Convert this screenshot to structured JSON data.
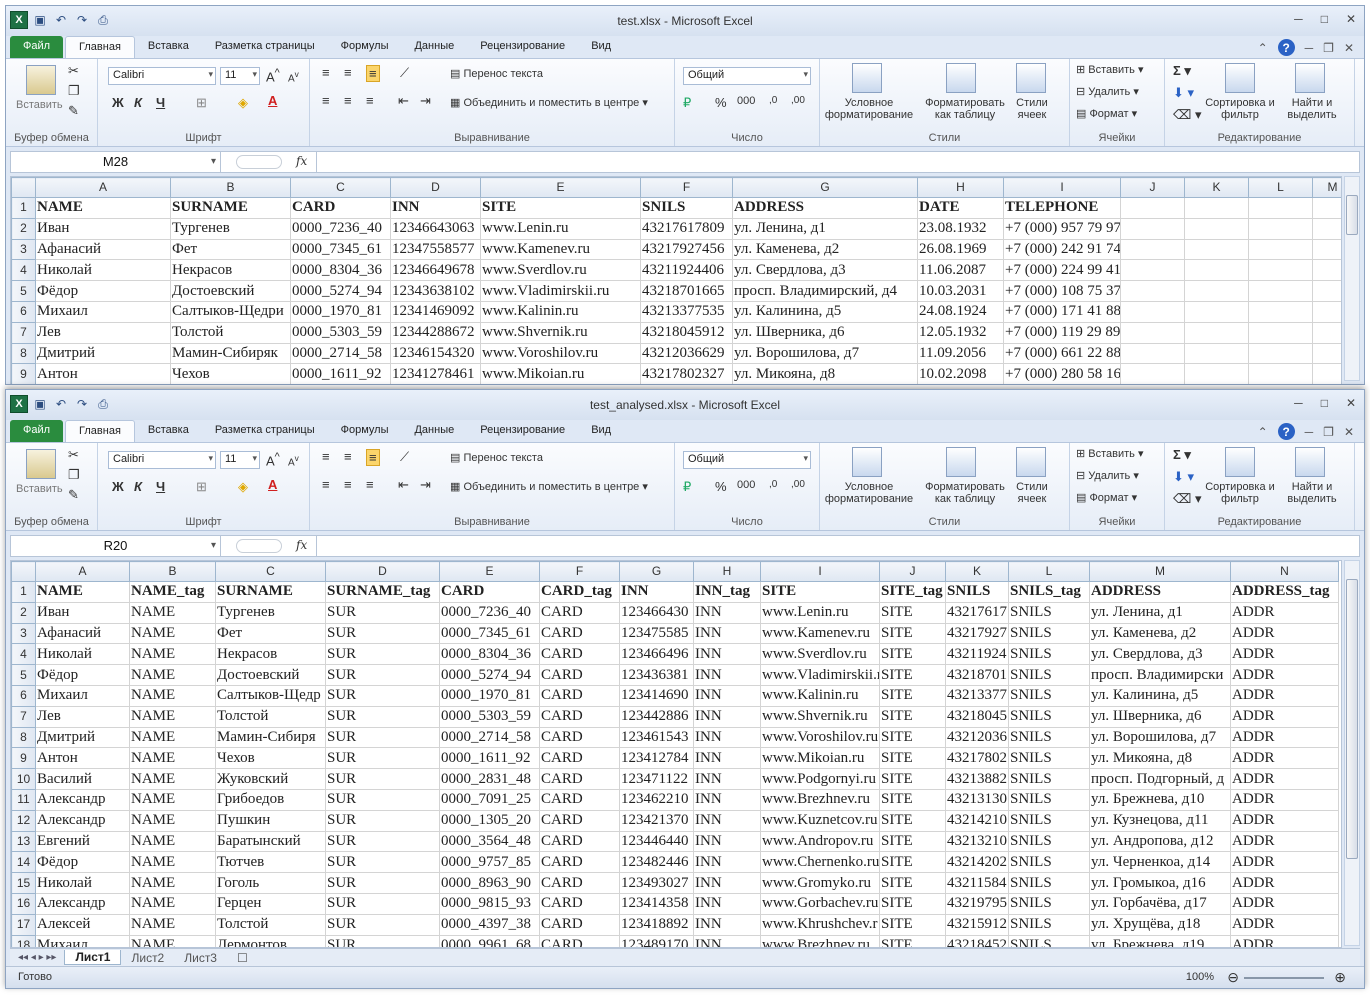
{
  "app": {
    "quick_access": [
      "save-icon",
      "undo-icon",
      "redo-icon",
      "print-preview-icon"
    ]
  },
  "window1": {
    "title": "test.xlsx  -  Microsoft Excel",
    "tabs": [
      "Файл",
      "Главная",
      "Вставка",
      "Разметка страницы",
      "Формулы",
      "Данные",
      "Рецензирование",
      "Вид"
    ],
    "namebox": "M28",
    "columns": [
      "A",
      "B",
      "C",
      "D",
      "E",
      "F",
      "G",
      "H",
      "I",
      "J",
      "K",
      "L",
      "M"
    ],
    "rows": [
      [
        "NAME",
        "SURNAME",
        "CARD",
        "INN",
        "SITE",
        "SNILS",
        "ADDRESS",
        "DATE",
        "TELEPHONE",
        "",
        "",
        "",
        ""
      ],
      [
        "Иван",
        "Тургенев",
        "0000_7236_40",
        "12346643063",
        "www.Lenin.ru",
        "43217617809",
        "ул. Ленина, д1",
        "23.08.1932",
        "+7 (000) 957 79 97",
        "",
        "",
        "",
        ""
      ],
      [
        "Афанасий",
        "Фет",
        "0000_7345_61",
        "12347558577",
        "www.Kamenev.ru",
        "43217927456",
        "ул. Каменева, д2",
        "26.08.1969",
        "+7 (000) 242 91 74",
        "",
        "",
        "",
        ""
      ],
      [
        "Николай",
        "Некрасов",
        "0000_8304_36",
        "12346649678",
        "www.Sverdlov.ru",
        "43211924406",
        "ул. Свердлова, д3",
        "11.06.2087",
        "+7 (000) 224 99 41",
        "",
        "",
        "",
        ""
      ],
      [
        "Фёдор",
        "Достоевский",
        "0000_5274_94",
        "12343638102",
        "www.Vladimirskii.ru",
        "43218701665",
        "просп. Владимирский, д4",
        "10.03.2031",
        "+7 (000) 108 75 37",
        "",
        "",
        "",
        ""
      ],
      [
        "Михаил",
        "Салтыков-Щедри",
        "0000_1970_81",
        "12341469092",
        "www.Kalinin.ru",
        "43213377535",
        "ул. Калинина, д5",
        "24.08.1924",
        "+7 (000) 171 41 88",
        "",
        "",
        "",
        ""
      ],
      [
        "Лев",
        "Толстой",
        "0000_5303_59",
        "12344288672",
        "www.Shvernik.ru",
        "43218045912",
        "ул. Шверника, д6",
        "12.05.1932",
        "+7 (000) 119 29 89",
        "",
        "",
        "",
        ""
      ],
      [
        "Дмитрий",
        "Мамин-Сибиряк",
        "0000_2714_58",
        "12346154320",
        "www.Voroshilov.ru",
        "43212036629",
        "ул. Ворошилова, д7",
        "11.09.2056",
        "+7 (000) 661 22 88",
        "",
        "",
        "",
        ""
      ],
      [
        "Антон",
        "Чехов",
        "0000_1611_92",
        "12341278461",
        "www.Mikoian.ru",
        "43217802327",
        "ул. Микояна, д8",
        "10.02.2098",
        "+7 (000) 280 58 16",
        "",
        "",
        "",
        ""
      ]
    ]
  },
  "window2": {
    "title": "test_analysed.xlsx  -  Microsoft Excel",
    "tabs": [
      "Файл",
      "Главная",
      "Вставка",
      "Разметка страницы",
      "Формулы",
      "Данные",
      "Рецензирование",
      "Вид"
    ],
    "namebox": "R20",
    "columns": [
      "A",
      "B",
      "C",
      "D",
      "E",
      "F",
      "G",
      "H",
      "I",
      "J",
      "K",
      "L",
      "M",
      "N"
    ],
    "rows": [
      [
        "NAME",
        "NAME_tag",
        "SURNAME",
        "SURNAME_tag",
        "CARD",
        "CARD_tag",
        "INN",
        "INN_tag",
        "SITE",
        "SITE_tag",
        "SNILS",
        "SNILS_tag",
        "ADDRESS",
        "ADDRESS_tag"
      ],
      [
        "Иван",
        "NAME",
        "Тургенев",
        "SUR",
        "0000_7236_40",
        "CARD",
        "123466430",
        "INN",
        "www.Lenin.ru",
        "SITE",
        "43217617",
        "SNILS",
        "ул. Ленина, д1",
        "ADDR"
      ],
      [
        "Афанасий",
        "NAME",
        "Фет",
        "SUR",
        "0000_7345_61",
        "CARD",
        "123475585",
        "INN",
        "www.Kamenev.ru",
        "SITE",
        "43217927",
        "SNILS",
        "ул. Каменева, д2",
        "ADDR"
      ],
      [
        "Николай",
        "NAME",
        "Некрасов",
        "SUR",
        "0000_8304_36",
        "CARD",
        "123466496",
        "INN",
        "www.Sverdlov.ru",
        "SITE",
        "43211924",
        "SNILS",
        "ул. Свердлова, д3",
        "ADDR"
      ],
      [
        "Фёдор",
        "NAME",
        "Достоевский",
        "SUR",
        "0000_5274_94",
        "CARD",
        "123436381",
        "INN",
        "www.Vladimirskii.r",
        "SITE",
        "43218701",
        "SNILS",
        "просп. Владимирски",
        "ADDR"
      ],
      [
        "Михаил",
        "NAME",
        "Салтыков-Щедр",
        "SUR",
        "0000_1970_81",
        "CARD",
        "123414690",
        "INN",
        "www.Kalinin.ru",
        "SITE",
        "43213377",
        "SNILS",
        "ул. Калинина, д5",
        "ADDR"
      ],
      [
        "Лев",
        "NAME",
        "Толстой",
        "SUR",
        "0000_5303_59",
        "CARD",
        "123442886",
        "INN",
        "www.Shvernik.ru",
        "SITE",
        "43218045",
        "SNILS",
        "ул. Шверника, д6",
        "ADDR"
      ],
      [
        "Дмитрий",
        "NAME",
        "Мамин-Сибиря",
        "SUR",
        "0000_2714_58",
        "CARD",
        "123461543",
        "INN",
        "www.Voroshilov.ru",
        "SITE",
        "43212036",
        "SNILS",
        "ул. Ворошилова, д7",
        "ADDR"
      ],
      [
        "Антон",
        "NAME",
        "Чехов",
        "SUR",
        "0000_1611_92",
        "CARD",
        "123412784",
        "INN",
        "www.Mikoian.ru",
        "SITE",
        "43217802",
        "SNILS",
        "ул. Микояна, д8",
        "ADDR"
      ],
      [
        "Василий",
        "NAME",
        "Жуковский",
        "SUR",
        "0000_2831_48",
        "CARD",
        "123471122",
        "INN",
        "www.Podgornyi.ru",
        "SITE",
        "43213882",
        "SNILS",
        "просп. Подгорный, д",
        "ADDR"
      ],
      [
        "Александр",
        "NAME",
        "Грибоедов",
        "SUR",
        "0000_7091_25",
        "CARD",
        "123462210",
        "INN",
        "www.Brezhnev.ru",
        "SITE",
        "43213130",
        "SNILS",
        "ул. Брежнева, д10",
        "ADDR"
      ],
      [
        "Александр",
        "NAME",
        "Пушкин",
        "SUR",
        "0000_1305_20",
        "CARD",
        "123421370",
        "INN",
        "www.Kuznetcov.ru",
        "SITE",
        "43214210",
        "SNILS",
        "ул. Кузнецова, д11",
        "ADDR"
      ],
      [
        "Евгений",
        "NAME",
        "Баратынский",
        "SUR",
        "0000_3564_48",
        "CARD",
        "123446440",
        "INN",
        "www.Andropov.ru",
        "SITE",
        "43213210",
        "SNILS",
        "ул. Андропова, д12",
        "ADDR"
      ],
      [
        "Фёдор",
        "NAME",
        "Тютчев",
        "SUR",
        "0000_9757_85",
        "CARD",
        "123482446",
        "INN",
        "www.Chernenko.ru",
        "SITE",
        "43214202",
        "SNILS",
        "ул. Черненкоа, д14",
        "ADDR"
      ],
      [
        "Николай",
        "NAME",
        "Гоголь",
        "SUR",
        "0000_8963_90",
        "CARD",
        "123493027",
        "INN",
        "www.Gromyko.ru",
        "SITE",
        "43211584",
        "SNILS",
        "ул. Громыкоа, д16",
        "ADDR"
      ],
      [
        "Александр",
        "NAME",
        "Герцен",
        "SUR",
        "0000_9815_93",
        "CARD",
        "123414358",
        "INN",
        "www.Gorbachev.ru",
        "SITE",
        "43219795",
        "SNILS",
        "ул. Горбачёва, д17",
        "ADDR"
      ],
      [
        "Алексей",
        "NAME",
        "Толстой",
        "SUR",
        "0000_4397_38",
        "CARD",
        "123418892",
        "INN",
        "www.Khrushchev.r",
        "SITE",
        "43215912",
        "SNILS",
        "ул. Хрущёва, д18",
        "ADDR"
      ],
      [
        "Михаил",
        "NAME",
        "Лермонтов",
        "SUR",
        "0000_9961_68",
        "CARD",
        "123489170",
        "INN",
        "www.Brezhnev.ru",
        "SITE",
        "43218452",
        "SNILS",
        "ул. Брежнева, д19",
        "ADDR"
      ]
    ],
    "sheets": [
      "Лист1",
      "Лист2",
      "Лист3"
    ],
    "status": "Готово",
    "zoom": "100%"
  },
  "ribbon": {
    "clipboard_group": "Буфер обмена",
    "paste": "Вставить",
    "font_group": "Шрифт",
    "font_name": "Calibri",
    "font_size": "11",
    "bold": "Ж",
    "italic": "К",
    "underline": "Ч",
    "alignment_group": "Выравнивание",
    "wrap_text": "Перенос текста",
    "merge_center": "Объединить и поместить в центре",
    "number_group": "Число",
    "number_format": "Общий",
    "styles_group": "Стили",
    "conditional": "Условное форматирование",
    "format_table": "Форматировать как таблицу",
    "cell_styles": "Стили ячеек",
    "cells_group": "Ячейки",
    "insert": "Вставить",
    "delete": "Удалить",
    "format": "Формат",
    "editing_group": "Редактирование",
    "sort": "Сортировка и фильтр",
    "find": "Найти и выделить"
  }
}
